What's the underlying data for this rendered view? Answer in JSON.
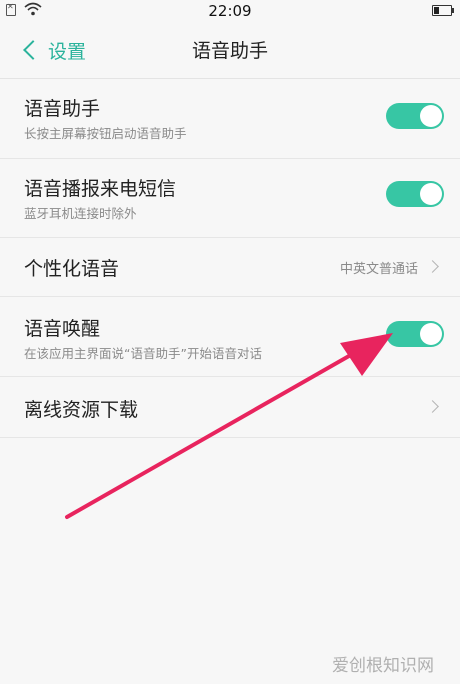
{
  "status_bar": {
    "time": "22:09"
  },
  "nav": {
    "back_label": "设置",
    "title": "语音助手"
  },
  "rows": [
    {
      "title": "语音助手",
      "subtitle": "长按主屏幕按钮启动语音助手",
      "toggle_on": true
    },
    {
      "title": "语音播报来电短信",
      "subtitle": "蓝牙耳机连接时除外",
      "toggle_on": true
    },
    {
      "title": "个性化语音",
      "value": "中英文普通话"
    },
    {
      "title": "语音唤醒",
      "subtitle": "在该应用主界面说“语音助手”开始语音对话",
      "toggle_on": true
    },
    {
      "title": "离线资源下载"
    }
  ],
  "colors": {
    "accent": "#2bb39c",
    "toggle_on": "#37c6a4",
    "annotation_arrow": "#e8245e"
  },
  "watermark": "爱创根知识网"
}
